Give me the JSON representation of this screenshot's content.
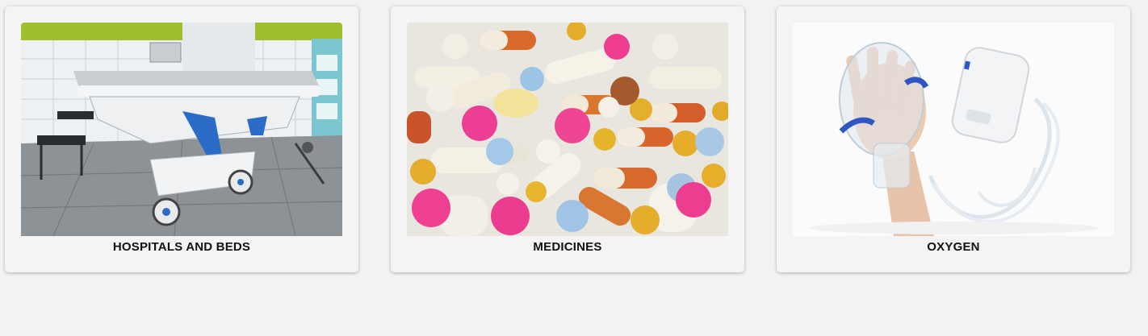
{
  "cards": [
    {
      "title": "HOSPITALS AND BEDS",
      "image": "hospital-bed-image"
    },
    {
      "title": "MEDICINES",
      "image": "medicine-pills-image"
    },
    {
      "title": "OXYGEN",
      "image": "oxygen-nebulizer-image"
    }
  ],
  "colors": {
    "page_background": "#f2f2f2",
    "card_background": "#f4f4f4",
    "caption_text": "#111111"
  }
}
